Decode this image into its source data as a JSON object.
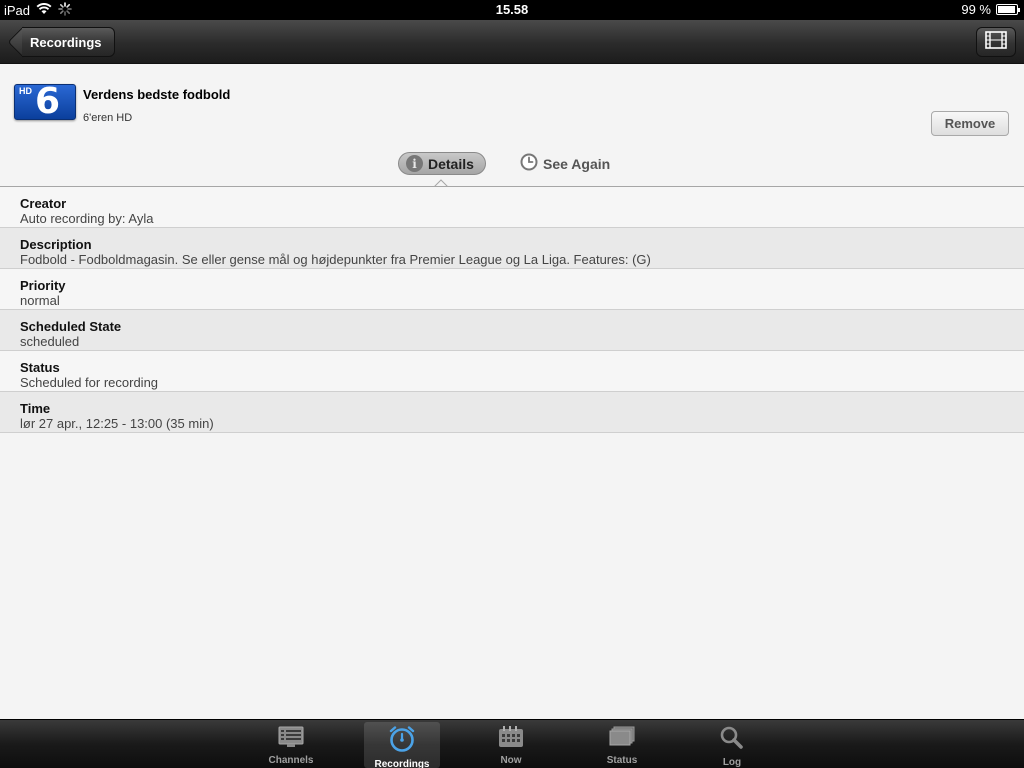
{
  "status_bar": {
    "device": "iPad",
    "time": "15.58",
    "battery": "99 %"
  },
  "nav": {
    "back_label": "Recordings"
  },
  "program": {
    "title": "Verdens bedste fodbold",
    "channel": "6'eren HD",
    "logo_hd": "HD",
    "logo_number": "6",
    "remove_label": "Remove"
  },
  "tabs": {
    "details": "Details",
    "see_again": "See Again",
    "selected": "details"
  },
  "details": [
    {
      "label": "Creator",
      "value": "Auto recording by: Ayla"
    },
    {
      "label": "Description",
      "value": "Fodbold - Fodboldmagasin. Se eller gense mål og højdepunkter fra Premier League og La Liga. Features: (G)"
    },
    {
      "label": "Priority",
      "value": "normal"
    },
    {
      "label": "Scheduled State",
      "value": "scheduled"
    },
    {
      "label": "Status",
      "value": "Scheduled for recording"
    },
    {
      "label": "Time",
      "value": "lør 27 apr., 12:25 - 13:00 (35 min)"
    }
  ],
  "tab_bar": [
    {
      "label": "Channels",
      "icon": "list-icon"
    },
    {
      "label": "Recordings",
      "icon": "alarm-clock-icon",
      "selected": true
    },
    {
      "label": "Now",
      "icon": "calendar-icon"
    },
    {
      "label": "Status",
      "icon": "stack-icon"
    },
    {
      "label": "Log",
      "icon": "magnifier-icon"
    }
  ],
  "colors": {
    "accent": "#4ba3e8",
    "logo_blue": "#1a55c0"
  }
}
